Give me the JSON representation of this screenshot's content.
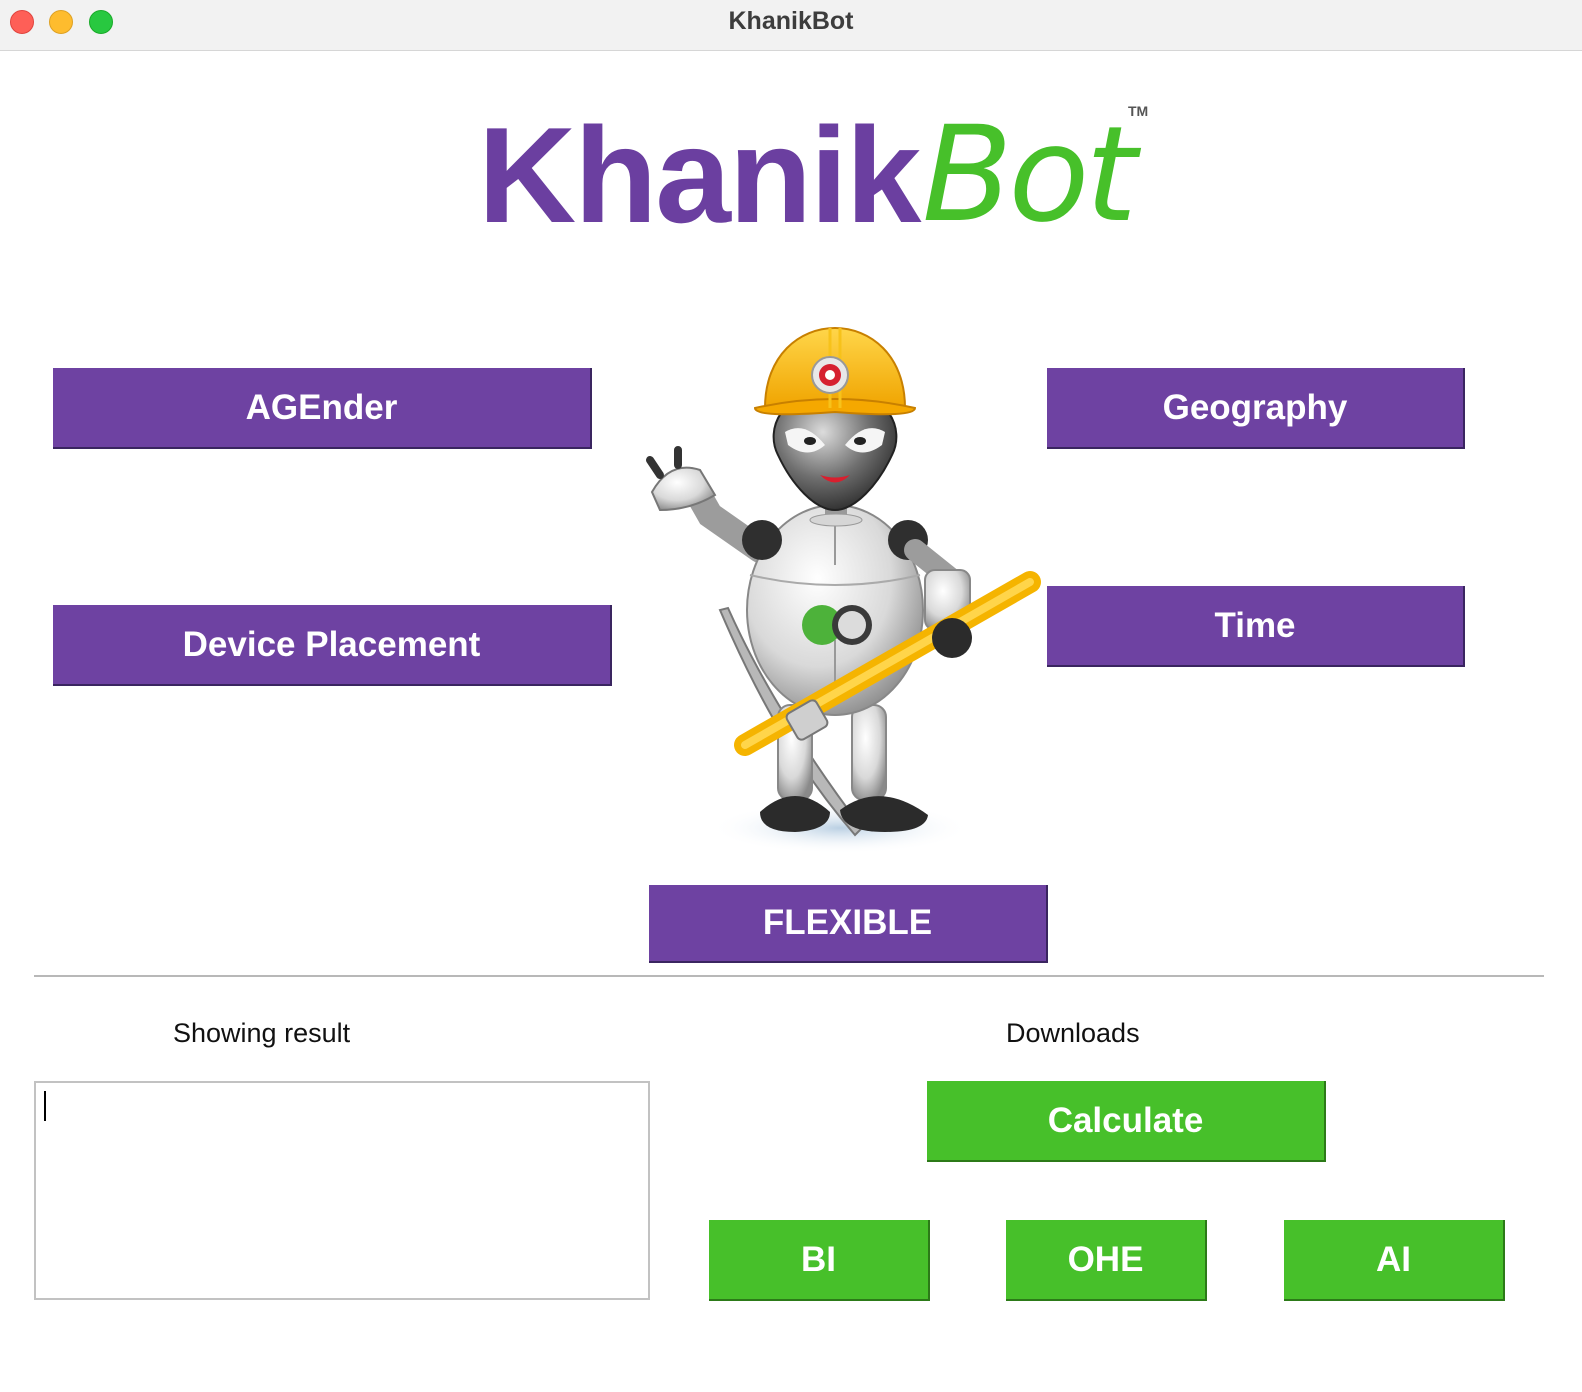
{
  "window": {
    "title": "KhanikBot"
  },
  "logo": {
    "part1": "Khanik",
    "part2": "Bot",
    "trademark": "TM",
    "colors": {
      "part1": "#6b3fa0",
      "part2": "#47c02a"
    }
  },
  "mascot": {
    "icon": "miner-robot-mascot-icon"
  },
  "buttons": {
    "agender": "AGEnder",
    "device_placement": "Device Placement",
    "geography": "Geography",
    "time": "Time",
    "flexible": "FLEXIBLE",
    "calculate": "Calculate",
    "bi": "BI",
    "ohe": "OHE",
    "ai": "AI"
  },
  "results": {
    "label": "Showing result",
    "value": ""
  },
  "downloads": {
    "label": "Downloads"
  },
  "colors": {
    "purple_button": "#6e42a2",
    "green_button": "#47c02a"
  }
}
